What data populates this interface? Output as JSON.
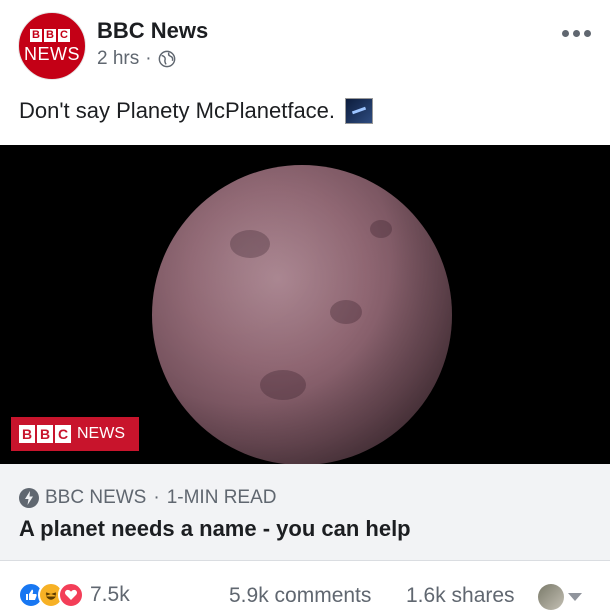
{
  "post": {
    "page_name": "BBC News",
    "avatar": {
      "logo_letters": [
        "B",
        "B",
        "C"
      ],
      "logo_word": "NEWS"
    },
    "time": "2 hrs",
    "separator": "·",
    "audience_icon": "globe-icon",
    "caption": "Don't say Planety McPlanetface.",
    "caption_emoji": "night-sky-emoji"
  },
  "link": {
    "watermark": {
      "letters": [
        "B",
        "B",
        "C"
      ],
      "word": "NEWS"
    },
    "source": "BBC NEWS",
    "separator": "·",
    "read_time": "1-MIN READ",
    "title": "A planet needs a name - you can help"
  },
  "engagement": {
    "reaction_icons": [
      "like-icon",
      "haha-icon",
      "love-icon"
    ],
    "reaction_count": "7.5k",
    "comments": "5.9k comments",
    "shares": "1.6k shares"
  },
  "colors": {
    "bbc_red": "#c40016",
    "facebook_blue": "#1877f2",
    "secondary_text": "#606770",
    "footer_bg": "#f2f3f5"
  }
}
